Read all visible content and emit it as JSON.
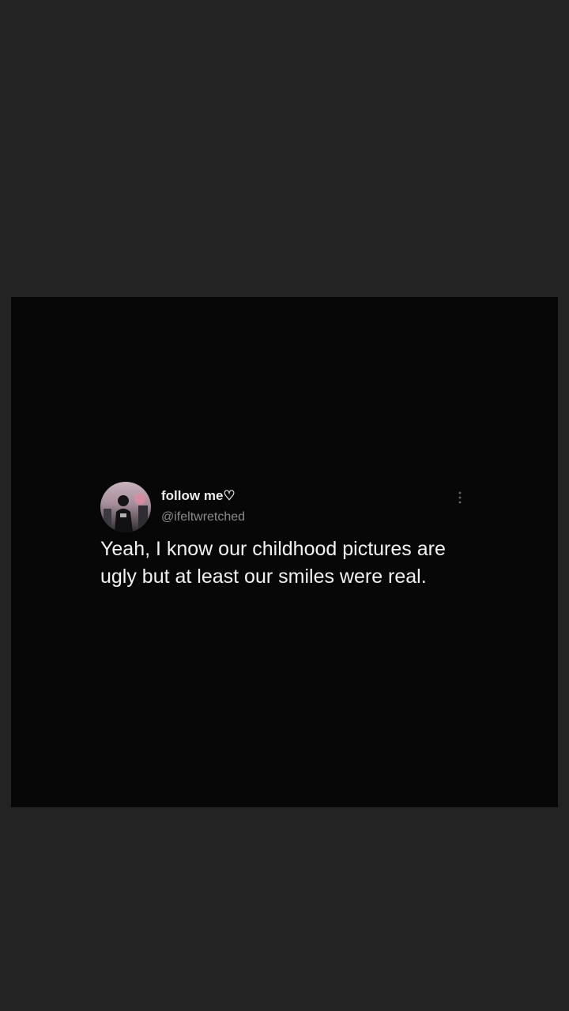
{
  "tweet": {
    "display_name": "follow me♡",
    "handle": "@ifeltwretched",
    "text": "Yeah, I know our childhood pictures are ugly but at least our smiles were real.",
    "avatar_icon": "person-silhouette-icon",
    "more_icon": "more-vertical-icon"
  },
  "colors": {
    "page_background": "#232323",
    "card_background": "#070707",
    "name_text": "#ededed",
    "handle_text": "#8b8b8b",
    "body_text": "#f2f2f2"
  }
}
